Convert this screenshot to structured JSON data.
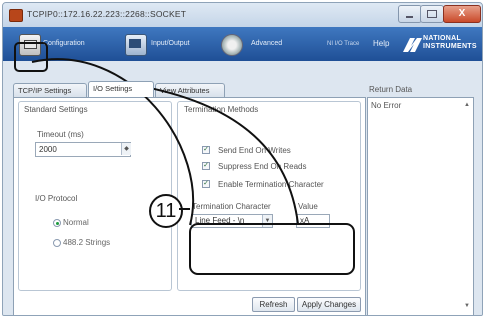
{
  "window": {
    "title": "TCPIP0::172.16.22.223::2268::SOCKET",
    "close_symbol": "X"
  },
  "toolbar": {
    "items": [
      {
        "label": "Configuration"
      },
      {
        "label": "Input/Output"
      },
      {
        "label": "Advanced"
      },
      {
        "label": "NI I/O Trace"
      }
    ],
    "help_label": "Help",
    "logo_line1": "NATIONAL",
    "logo_line2": "INSTRUMENTS"
  },
  "tabs": [
    "TCP/IP Settings",
    "I/O Settings",
    "View Attributes"
  ],
  "active_tab": "I/O Settings",
  "standard_settings": {
    "title": "Standard Settings",
    "timeout_label": "Timeout (ms)",
    "timeout_value": "2000",
    "io_protocol_label": "I/O Protocol",
    "protocol_options": [
      "Normal",
      "488.2 Strings"
    ],
    "selected_protocol": "Normal"
  },
  "termination": {
    "title": "Termination Methods",
    "checkboxes": [
      {
        "label": "Send End On Writes",
        "checked": true
      },
      {
        "label": "Suppress End On Reads",
        "checked": true
      },
      {
        "label": "Enable Termination Character",
        "checked": true
      }
    ],
    "term_char_label": "Termination Character",
    "term_char_value": "Line Feed - \\n",
    "value_label": "Value",
    "value_value": "xA"
  },
  "buttons": {
    "refresh": "Refresh",
    "apply": "Apply Changes"
  },
  "return_data": {
    "label": "Return Data",
    "value": "No Error"
  },
  "annotation": {
    "marker": "11"
  },
  "colors": {
    "toolbar": "#2a5fa8",
    "callout": "#111111",
    "radio_selected": "#1d9b3e"
  }
}
